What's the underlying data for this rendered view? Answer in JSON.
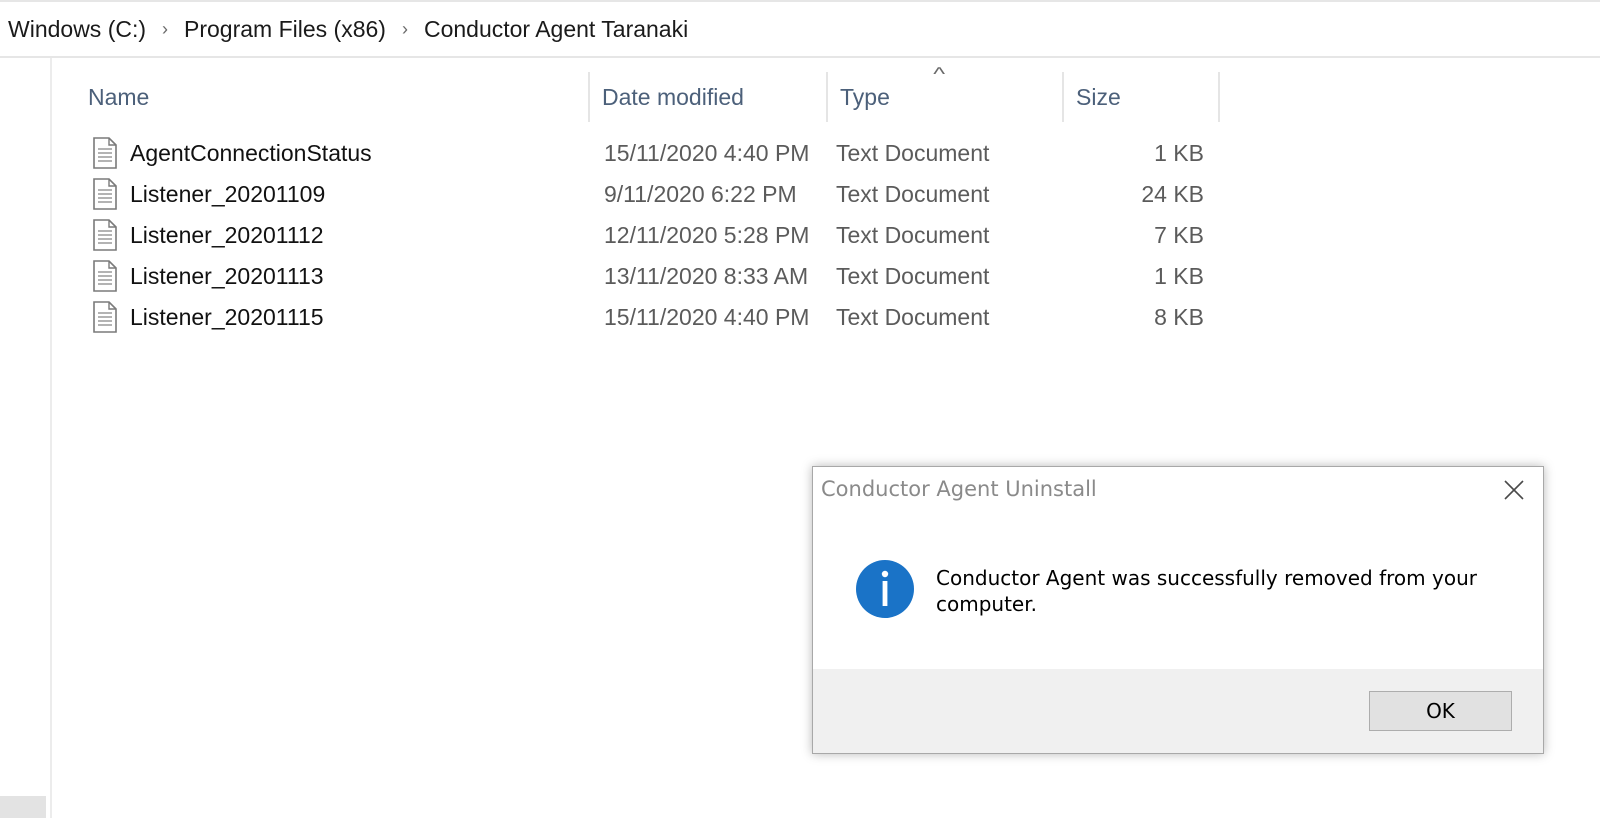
{
  "breadcrumb": {
    "items": [
      "Windows (C:)",
      "Program Files (x86)",
      "Conductor Agent Taranaki"
    ],
    "separator": "›"
  },
  "columns": {
    "name": "Name",
    "date_modified": "Date modified",
    "type": "Type",
    "size": "Size",
    "sort_indicator": "^"
  },
  "files": [
    {
      "name": "AgentConnectionStatus",
      "date_modified": "15/11/2020 4:40 PM",
      "type": "Text Document",
      "size": "1 KB",
      "icon": "text-document-icon"
    },
    {
      "name": "Listener_20201109",
      "date_modified": "9/11/2020 6:22 PM",
      "type": "Text Document",
      "size": "24 KB",
      "icon": "text-document-icon"
    },
    {
      "name": "Listener_20201112",
      "date_modified": "12/11/2020 5:28 PM",
      "type": "Text Document",
      "size": "7 KB",
      "icon": "text-document-icon"
    },
    {
      "name": "Listener_20201113",
      "date_modified": "13/11/2020 8:33 AM",
      "type": "Text Document",
      "size": "1 KB",
      "icon": "text-document-icon"
    },
    {
      "name": "Listener_20201115",
      "date_modified": "15/11/2020 4:40 PM",
      "type": "Text Document",
      "size": "8 KB",
      "icon": "text-document-icon"
    }
  ],
  "dialog": {
    "title": "Conductor Agent Uninstall",
    "message": "Conductor Agent was successfully removed from your computer.",
    "icon": "info-icon",
    "ok_label": "OK",
    "close_icon": "close-icon"
  },
  "colors": {
    "header_text": "#4c607a",
    "info_blue": "#1a73c7",
    "dialog_footer": "#f0f0f0"
  }
}
